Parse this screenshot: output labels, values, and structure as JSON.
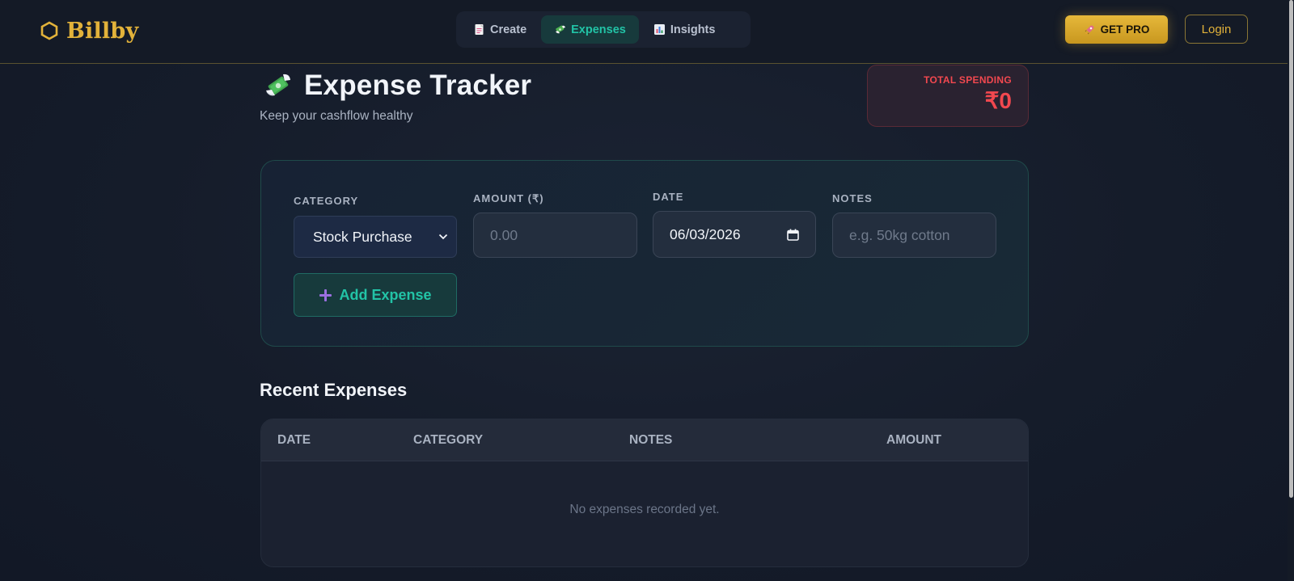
{
  "brand": {
    "name": "Billby",
    "color": "#e2b23a",
    "icon": "hexagon-icon"
  },
  "nav": {
    "tabs": [
      {
        "label": "Create",
        "icon": "document-icon",
        "active": false
      },
      {
        "label": "Expenses",
        "icon": "money-wings-icon",
        "active": true
      },
      {
        "label": "Insights",
        "icon": "bar-chart-icon",
        "active": false
      }
    ],
    "get_pro_label": "GET PRO",
    "get_pro_icon": "rocket-icon",
    "login_label": "Login"
  },
  "header": {
    "title": "Expense Tracker",
    "title_icon": "money-wings-icon",
    "subtitle": "Keep your cashflow healthy",
    "total_label": "TOTAL SPENDING",
    "total_value": "₹0"
  },
  "form": {
    "category_label": "CATEGORY",
    "category_value": "Stock Purchase",
    "amount_label": "AMOUNT (₹)",
    "amount_placeholder": "0.00",
    "date_label": "DATE",
    "date_value": "06/03/2026",
    "notes_label": "NOTES",
    "notes_placeholder": "e.g. 50kg cotton",
    "add_button_label": "Add Expense"
  },
  "recent": {
    "title": "Recent Expenses",
    "columns": [
      "DATE",
      "CATEGORY",
      "NOTES",
      "AMOUNT"
    ],
    "empty_message": "No expenses recorded yet."
  },
  "colors": {
    "accent_teal": "#22c3a6",
    "accent_gold": "#e2b23a",
    "danger_red": "#f2484f",
    "background": "#151c2a"
  }
}
